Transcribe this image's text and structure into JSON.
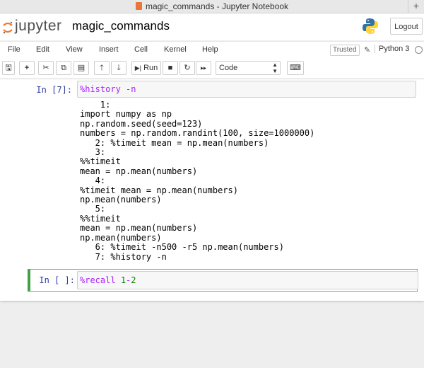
{
  "window": {
    "title": "magic_commands - Jupyter Notebook"
  },
  "header": {
    "logo_text": "jupyter",
    "notebook_name": "magic_commands",
    "logout_label": "Logout"
  },
  "menubar": {
    "items": [
      "File",
      "Edit",
      "View",
      "Insert",
      "Cell",
      "Kernel",
      "Help"
    ],
    "trusted_label": "Trusted",
    "kernel_name": "Python 3"
  },
  "toolbar": {
    "run_label": "Run",
    "cell_type": "Code"
  },
  "cells": [
    {
      "prompt": "In [7]:",
      "input": {
        "magic": "%history",
        "args": "-n"
      },
      "output": "    1:\nimport numpy as np\nnp.random.seed(seed=123)\nnumbers = np.random.randint(100, size=1000000)\n   2: %timeit mean = np.mean(numbers)\n   3:\n%%timeit\nmean = np.mean(numbers)\n   4:\n%timeit mean = np.mean(numbers)\nnp.mean(numbers)\n   5:\n%%timeit\nmean = np.mean(numbers)\nnp.mean(numbers)\n   6: %timeit -n500 -r5 np.mean(numbers)\n   7: %history -n"
    },
    {
      "prompt": "In [ ]:",
      "input": {
        "magic": "%recall",
        "n1": "1",
        "op": "-",
        "n2": "2"
      }
    }
  ]
}
